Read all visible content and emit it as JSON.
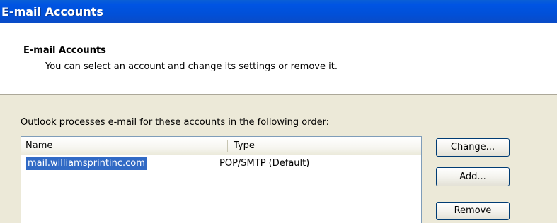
{
  "window": {
    "title": "E-mail Accounts"
  },
  "header": {
    "title": "E-mail Accounts",
    "description": "You can select an account and change its settings or remove it."
  },
  "accounts": {
    "order_label": "Outlook processes e-mail for these accounts in the following order:",
    "columns": [
      "Name",
      "Type"
    ],
    "rows": [
      {
        "name": "mail.williamsprintinc.com",
        "type": "POP/SMTP (Default)",
        "selected": true
      }
    ]
  },
  "buttons": {
    "change": "Change...",
    "add": "Add...",
    "remove": "Remove"
  },
  "colors": {
    "titlebar": "#0054e3",
    "selection": "#316ac5",
    "dialog_bg": "#ece9d8"
  }
}
